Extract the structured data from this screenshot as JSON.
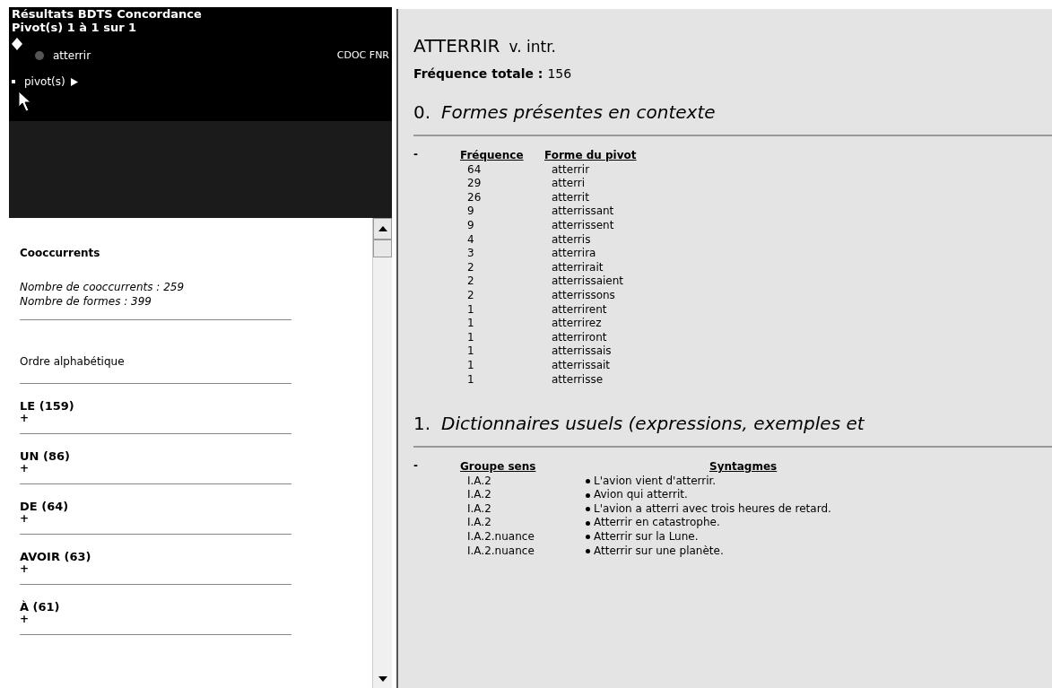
{
  "header": {
    "title": "Résultats BDTS Concordance",
    "subtitle": "Pivot(s) 1 à 1 sur 1",
    "pivot": {
      "label": "atterrir",
      "sources": "CDOC FNR"
    },
    "pivot_nav": "pivot(s)"
  },
  "cooccurrents": {
    "heading": "Cooccurrents",
    "stats": [
      "Nombre de cooccurrents : 259",
      "Nombre de formes : 399"
    ],
    "sort": "Ordre alphabétique",
    "items": [
      {
        "label": "LE (159)",
        "toggle": "+"
      },
      {
        "label": "UN (86)",
        "toggle": "+"
      },
      {
        "label": "DE (64)",
        "toggle": "+"
      },
      {
        "label": "AVOIR (63)",
        "toggle": "+"
      },
      {
        "label": "À (61)",
        "toggle": "+"
      }
    ]
  },
  "entry": {
    "headword": "ATTERRIR",
    "category": "v. intr.",
    "frequency_label": "Fréquence totale :",
    "frequency": "156",
    "sections": [
      {
        "number": "0.",
        "title": "Formes présentes en contexte",
        "toggle": "-",
        "columns": [
          "Fréquence",
          "Forme du pivot"
        ],
        "rows": [
          [
            "64",
            "atterrir"
          ],
          [
            "29",
            "atterri"
          ],
          [
            "26",
            "atterrit"
          ],
          [
            "9",
            "atterrissant"
          ],
          [
            "9",
            "atterrissent"
          ],
          [
            "4",
            "atterris"
          ],
          [
            "3",
            "atterrira"
          ],
          [
            "2",
            "atterrirait"
          ],
          [
            "2",
            "atterrissaient"
          ],
          [
            "2",
            "atterrissons"
          ],
          [
            "1",
            "atterrirent"
          ],
          [
            "1",
            "atterrirez"
          ],
          [
            "1",
            "atterriront"
          ],
          [
            "1",
            "atterrissais"
          ],
          [
            "1",
            "atterrissait"
          ],
          [
            "1",
            "atterrisse"
          ]
        ]
      },
      {
        "number": "1.",
        "title": "Dictionnaires usuels (expressions, exemples et",
        "toggle": "-",
        "columns": [
          "Groupe sens",
          "Syntagmes"
        ],
        "rows": [
          [
            "I.A.2",
            "L'avion vient d'atterrir."
          ],
          [
            "I.A.2",
            "Avion qui atterrit."
          ],
          [
            "I.A.2",
            "L'avion a atterri avec trois heures de retard."
          ],
          [
            "I.A.2",
            "Atterrir en catastrophe."
          ],
          [
            "I.A.2.nuance",
            "Atterrir sur la Lune."
          ],
          [
            "I.A.2.nuance",
            "Atterrir sur une planète."
          ]
        ]
      }
    ]
  }
}
